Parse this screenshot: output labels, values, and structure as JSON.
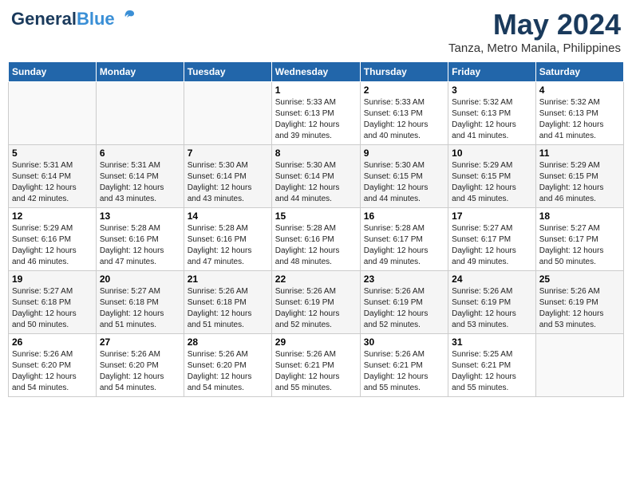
{
  "logo": {
    "line1": "General",
    "line2": "Blue"
  },
  "title": "May 2024",
  "location": "Tanza, Metro Manila, Philippines",
  "weekdays": [
    "Sunday",
    "Monday",
    "Tuesday",
    "Wednesday",
    "Thursday",
    "Friday",
    "Saturday"
  ],
  "weeks": [
    [
      {
        "day": "",
        "content": ""
      },
      {
        "day": "",
        "content": ""
      },
      {
        "day": "",
        "content": ""
      },
      {
        "day": "1",
        "content": "Sunrise: 5:33 AM\nSunset: 6:13 PM\nDaylight: 12 hours\nand 39 minutes."
      },
      {
        "day": "2",
        "content": "Sunrise: 5:33 AM\nSunset: 6:13 PM\nDaylight: 12 hours\nand 40 minutes."
      },
      {
        "day": "3",
        "content": "Sunrise: 5:32 AM\nSunset: 6:13 PM\nDaylight: 12 hours\nand 41 minutes."
      },
      {
        "day": "4",
        "content": "Sunrise: 5:32 AM\nSunset: 6:13 PM\nDaylight: 12 hours\nand 41 minutes."
      }
    ],
    [
      {
        "day": "5",
        "content": "Sunrise: 5:31 AM\nSunset: 6:14 PM\nDaylight: 12 hours\nand 42 minutes."
      },
      {
        "day": "6",
        "content": "Sunrise: 5:31 AM\nSunset: 6:14 PM\nDaylight: 12 hours\nand 43 minutes."
      },
      {
        "day": "7",
        "content": "Sunrise: 5:30 AM\nSunset: 6:14 PM\nDaylight: 12 hours\nand 43 minutes."
      },
      {
        "day": "8",
        "content": "Sunrise: 5:30 AM\nSunset: 6:14 PM\nDaylight: 12 hours\nand 44 minutes."
      },
      {
        "day": "9",
        "content": "Sunrise: 5:30 AM\nSunset: 6:15 PM\nDaylight: 12 hours\nand 44 minutes."
      },
      {
        "day": "10",
        "content": "Sunrise: 5:29 AM\nSunset: 6:15 PM\nDaylight: 12 hours\nand 45 minutes."
      },
      {
        "day": "11",
        "content": "Sunrise: 5:29 AM\nSunset: 6:15 PM\nDaylight: 12 hours\nand 46 minutes."
      }
    ],
    [
      {
        "day": "12",
        "content": "Sunrise: 5:29 AM\nSunset: 6:16 PM\nDaylight: 12 hours\nand 46 minutes."
      },
      {
        "day": "13",
        "content": "Sunrise: 5:28 AM\nSunset: 6:16 PM\nDaylight: 12 hours\nand 47 minutes."
      },
      {
        "day": "14",
        "content": "Sunrise: 5:28 AM\nSunset: 6:16 PM\nDaylight: 12 hours\nand 47 minutes."
      },
      {
        "day": "15",
        "content": "Sunrise: 5:28 AM\nSunset: 6:16 PM\nDaylight: 12 hours\nand 48 minutes."
      },
      {
        "day": "16",
        "content": "Sunrise: 5:28 AM\nSunset: 6:17 PM\nDaylight: 12 hours\nand 49 minutes."
      },
      {
        "day": "17",
        "content": "Sunrise: 5:27 AM\nSunset: 6:17 PM\nDaylight: 12 hours\nand 49 minutes."
      },
      {
        "day": "18",
        "content": "Sunrise: 5:27 AM\nSunset: 6:17 PM\nDaylight: 12 hours\nand 50 minutes."
      }
    ],
    [
      {
        "day": "19",
        "content": "Sunrise: 5:27 AM\nSunset: 6:18 PM\nDaylight: 12 hours\nand 50 minutes."
      },
      {
        "day": "20",
        "content": "Sunrise: 5:27 AM\nSunset: 6:18 PM\nDaylight: 12 hours\nand 51 minutes."
      },
      {
        "day": "21",
        "content": "Sunrise: 5:26 AM\nSunset: 6:18 PM\nDaylight: 12 hours\nand 51 minutes."
      },
      {
        "day": "22",
        "content": "Sunrise: 5:26 AM\nSunset: 6:19 PM\nDaylight: 12 hours\nand 52 minutes."
      },
      {
        "day": "23",
        "content": "Sunrise: 5:26 AM\nSunset: 6:19 PM\nDaylight: 12 hours\nand 52 minutes."
      },
      {
        "day": "24",
        "content": "Sunrise: 5:26 AM\nSunset: 6:19 PM\nDaylight: 12 hours\nand 53 minutes."
      },
      {
        "day": "25",
        "content": "Sunrise: 5:26 AM\nSunset: 6:19 PM\nDaylight: 12 hours\nand 53 minutes."
      }
    ],
    [
      {
        "day": "26",
        "content": "Sunrise: 5:26 AM\nSunset: 6:20 PM\nDaylight: 12 hours\nand 54 minutes."
      },
      {
        "day": "27",
        "content": "Sunrise: 5:26 AM\nSunset: 6:20 PM\nDaylight: 12 hours\nand 54 minutes."
      },
      {
        "day": "28",
        "content": "Sunrise: 5:26 AM\nSunset: 6:20 PM\nDaylight: 12 hours\nand 54 minutes."
      },
      {
        "day": "29",
        "content": "Sunrise: 5:26 AM\nSunset: 6:21 PM\nDaylight: 12 hours\nand 55 minutes."
      },
      {
        "day": "30",
        "content": "Sunrise: 5:26 AM\nSunset: 6:21 PM\nDaylight: 12 hours\nand 55 minutes."
      },
      {
        "day": "31",
        "content": "Sunrise: 5:25 AM\nSunset: 6:21 PM\nDaylight: 12 hours\nand 55 minutes."
      },
      {
        "day": "",
        "content": ""
      }
    ]
  ]
}
